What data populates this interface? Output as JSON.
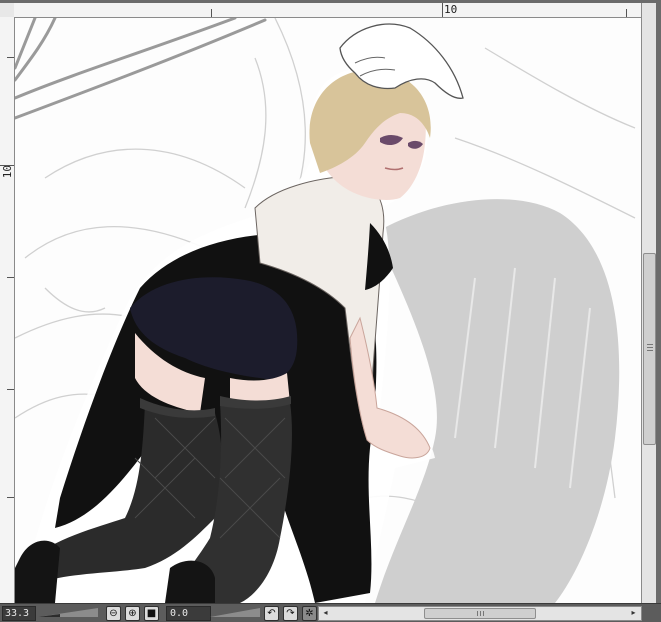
{
  "ruler": {
    "top_label": "10",
    "left_label": "10"
  },
  "toolbar": {
    "zoom_value": "33.3",
    "zoom_out_icon": "minus-circle-icon",
    "zoom_in_icon": "plus-circle-icon",
    "fit_icon": "square-icon",
    "angle_value": "0.0",
    "rotate_left_icon": "rotate-left-icon",
    "rotate_right_icon": "rotate-right-icon",
    "reset_rotation_icon": "gear-icon"
  },
  "scroll": {
    "left_arrow": "◂",
    "right_arrow": "▸"
  },
  "colors": {
    "canvas_bg": "#fdfdfd",
    "frame_bg": "#6b6b6b",
    "coat": "#111111",
    "stockings": "#2b2b2b",
    "hair": "#d8c49a",
    "skin": "#f4ddd6",
    "shirt": "#f1ede8",
    "sketch": "#bdbdbd"
  }
}
